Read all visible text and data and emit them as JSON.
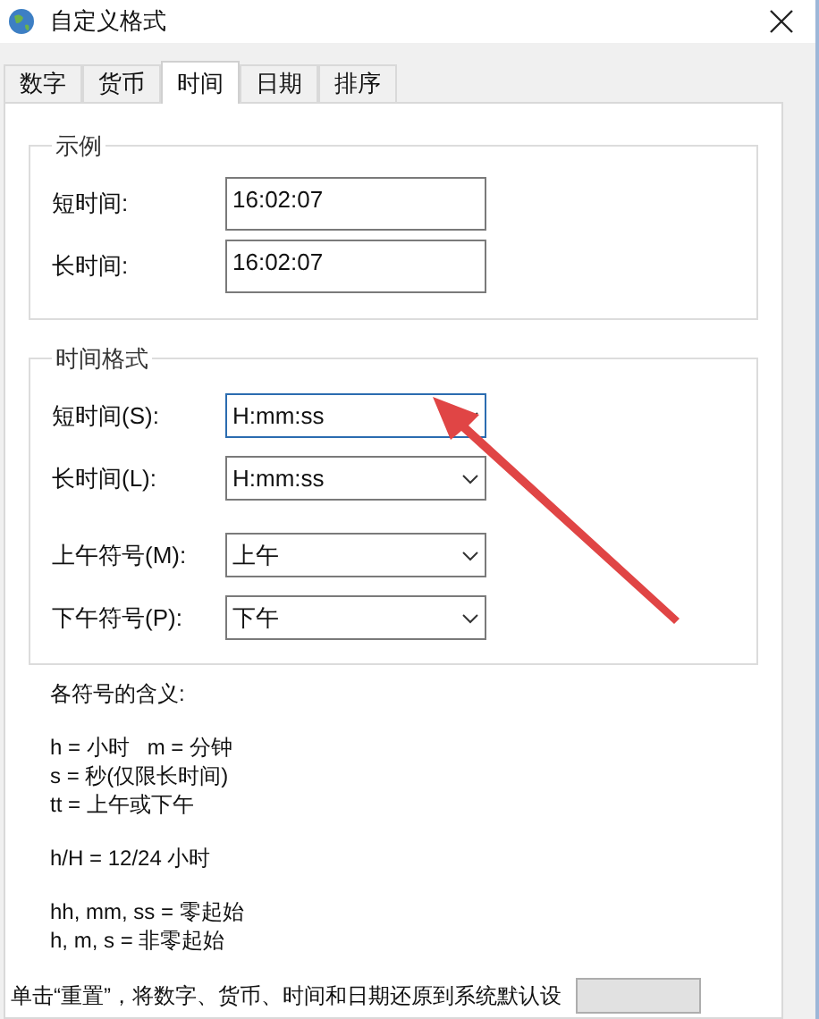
{
  "window": {
    "title": "自定义格式"
  },
  "tabs": [
    {
      "label": "数字",
      "selected": false
    },
    {
      "label": "货币",
      "selected": false
    },
    {
      "label": "时间",
      "selected": true
    },
    {
      "label": "日期",
      "selected": false
    },
    {
      "label": "排序",
      "selected": false
    }
  ],
  "example_group": {
    "title": "示例",
    "fields": [
      {
        "label": "短时间:",
        "value": "16:02:07"
      },
      {
        "label": "长时间:",
        "value": "16:02:07"
      }
    ]
  },
  "format_group": {
    "title": "时间格式",
    "fields": [
      {
        "label": "短时间(S):",
        "value": "H:mm:ss",
        "focused": true
      },
      {
        "label": "长时间(L):",
        "value": "H:mm:ss",
        "focused": false
      },
      {
        "label": "上午符号(M):",
        "value": "上午",
        "focused": false
      },
      {
        "label": "下午符号(P):",
        "value": "下午",
        "focused": false
      }
    ]
  },
  "legend": {
    "title": "各符号的含义:",
    "paragraphs": [
      [
        "h = 小时   m = 分钟",
        "s = 秒(仅限长时间)",
        "tt = 上午或下午"
      ],
      [
        "h/H = 12/24 小时"
      ],
      [
        "hh, mm, ss = 零起始",
        "h, m, s = 非零起始"
      ]
    ]
  },
  "footer": {
    "text": "单击“重置”，将数字、货币、时间和日期还原到系统默认设"
  }
}
